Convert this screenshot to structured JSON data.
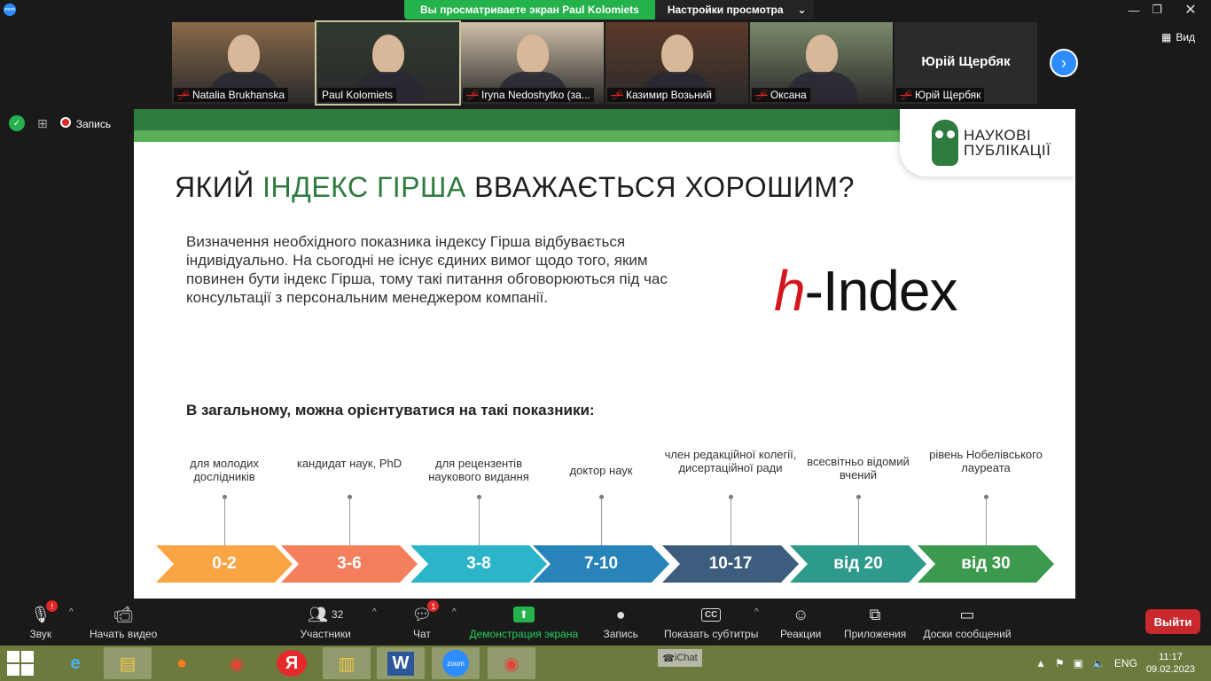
{
  "topbar": {
    "app_icon": "zoom",
    "share_banner": "Вы просматриваете экран Paul Kolomiets",
    "view_settings": "Настройки просмотра",
    "window_controls": [
      "minimize-icon",
      "restore-icon",
      "close-icon"
    ]
  },
  "participants": [
    {
      "name": "Natalia Brukhanska",
      "muted": true,
      "bg": "#8a6a4a"
    },
    {
      "name": "Paul Kolomiets",
      "muted": false,
      "bg": "#2f3a2f"
    },
    {
      "name": "Iryna Nedoshytko (за...",
      "muted": true,
      "bg": "#cfc0a8"
    },
    {
      "name": "Казимир Возьний",
      "muted": true,
      "bg": "#5c3a2a"
    },
    {
      "name": "Оксана",
      "muted": true,
      "bg": "#7a8a6a"
    },
    {
      "name": "Юрій Щербяк",
      "muted": true,
      "no_video": true,
      "big": "Юрій Щербяк"
    }
  ],
  "view_label": "Вид",
  "recording_label": "Запись",
  "slide": {
    "logo_text_1": "НАУКОВІ",
    "logo_text_2": "ПУБЛІКАЦІЇ",
    "title_part1": "ЯКИЙ ",
    "title_highlight": "ІНДЕКС ГІРША",
    "title_part2": " ВВАЖАЄТЬСЯ ХОРОШИМ?",
    "paragraph": "Визначення необхідного показника індексу Гірша відбувається індивідуально. На сьогодні не існує єдиних вимог щодо того, яким повинен бути індекс Гірша, тому такі питання обговорюються під час консультації з персональним менеджером компанії.",
    "hindex_h": "h",
    "hindex_rest": "-Index",
    "subhead": "В загальному, можна орієнтуватися на такі показники:",
    "scale": [
      {
        "label": "для молодих дослідників",
        "range": "0-2",
        "color": "#f9a543"
      },
      {
        "label": "кандидат наук, PhD",
        "range": "3-6",
        "color": "#f47f5c"
      },
      {
        "label": "для рецензентів наукового видання",
        "range": "3-8",
        "color": "#2cb4c9"
      },
      {
        "label": "доктор наук",
        "range": "7-10",
        "color": "#2883b8"
      },
      {
        "label": "член редакційної колегії, дисертаційної ради",
        "range": "10-17",
        "color": "#3d5c7e"
      },
      {
        "label": "всесвітньо відомий вчений",
        "range": "від 20",
        "color": "#2d9a8c"
      },
      {
        "label": "рівень Нобелівського лауреата",
        "range": "від 30",
        "color": "#3c9a4e"
      }
    ]
  },
  "toolbar": {
    "items": [
      {
        "id": "audio",
        "label": "Звук",
        "icon": "microphone-icon",
        "badge": "!"
      },
      {
        "id": "video",
        "label": "Начать видео",
        "icon": "video-off-icon"
      },
      {
        "id": "participants",
        "label": "Участники",
        "icon": "participants-icon",
        "count": "32"
      },
      {
        "id": "chat",
        "label": "Чат",
        "icon": "chat-icon",
        "badge": "1"
      },
      {
        "id": "share",
        "label": "Демонстрация экрана",
        "icon": "share-screen-icon"
      },
      {
        "id": "record",
        "label": "Запись",
        "icon": "record-icon"
      },
      {
        "id": "captions",
        "label": "Показать субтитры",
        "icon": "cc-icon",
        "icon_text": "CC"
      },
      {
        "id": "reactions",
        "label": "Реакции",
        "icon": "reactions-icon"
      },
      {
        "id": "apps",
        "label": "Приложения",
        "icon": "apps-icon"
      },
      {
        "id": "whiteboards",
        "label": "Доски сообщений",
        "icon": "whiteboard-icon"
      }
    ],
    "leave": "Выйти"
  },
  "taskbar": {
    "ichat": "iChat",
    "lang": "ENG",
    "time": "11:17",
    "date": "09.02.2023"
  }
}
